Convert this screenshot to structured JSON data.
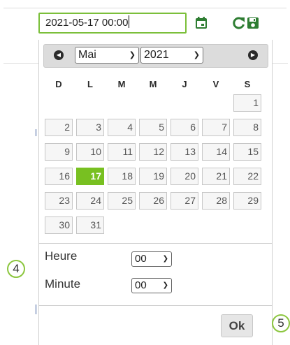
{
  "input": {
    "value": "2021-05-17 00:00"
  },
  "icons": {
    "calendar": "calendar-icon",
    "refresh": "refresh-icon",
    "save": "save-icon",
    "prev": "previous-month-icon",
    "next": "next-month-icon"
  },
  "header": {
    "month": "Mai",
    "year": "2021"
  },
  "weekdays": [
    "D",
    "L",
    "M",
    "M",
    "J",
    "V",
    "S"
  ],
  "weeks": [
    [
      "",
      "",
      "",
      "",
      "",
      "",
      "1"
    ],
    [
      "2",
      "3",
      "4",
      "5",
      "6",
      "7",
      "8"
    ],
    [
      "9",
      "10",
      "11",
      "12",
      "13",
      "14",
      "15"
    ],
    [
      "16",
      "17",
      "18",
      "19",
      "20",
      "21",
      "22"
    ],
    [
      "23",
      "24",
      "25",
      "26",
      "27",
      "28",
      "29"
    ],
    [
      "30",
      "31",
      "",
      "",
      "",
      "",
      ""
    ]
  ],
  "selected_day": "17",
  "time": {
    "hour_label": "Heure",
    "hour_value": "00",
    "minute_label": "Minute",
    "minute_value": "00"
  },
  "ok_label": "Ok",
  "callouts": {
    "left": "4",
    "right": "5"
  },
  "colors": {
    "accent": "#78c021",
    "input_border": "#7bbf3a"
  }
}
